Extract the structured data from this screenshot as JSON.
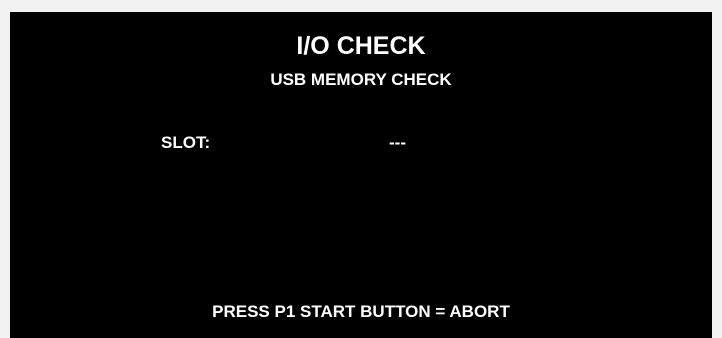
{
  "screen": {
    "title": "I/O CHECK",
    "subtitle": "USB MEMORY CHECK",
    "slot": {
      "label": "SLOT:",
      "value": "---"
    },
    "footer": "PRESS P1 START BUTTON = ABORT"
  },
  "colors": {
    "background": "#000000",
    "text": "#ffffff",
    "frame": "#f2f2f2"
  }
}
